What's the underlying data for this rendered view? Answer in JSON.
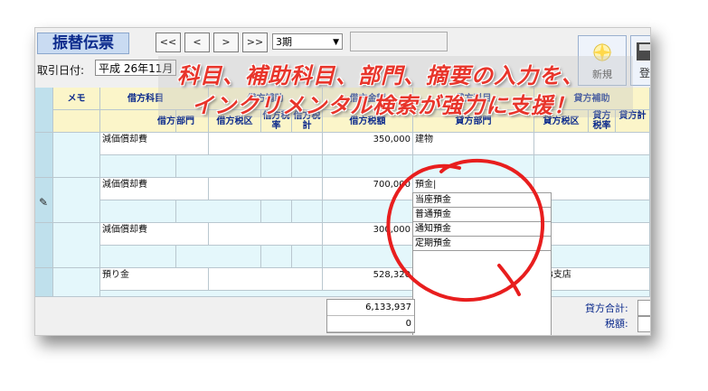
{
  "window": {
    "title": "振替伝票",
    "nav": [
      "<<",
      "<",
      ">",
      ">>"
    ],
    "period": "3期",
    "date_label": "取引日付:",
    "date_value": "平成 26年11月",
    "new_label": "新規",
    "register_label": "登"
  },
  "headers": {
    "memo": "メモ",
    "debit_account": "借方科目",
    "debit_sub": "借方補助",
    "debit_amount": "借方金額",
    "credit_account": "貸方科目",
    "credit_sub": "貸方補助",
    "debit_short": "借方",
    "dept": "部門",
    "debit_tax_class": "借方税区",
    "debit_tax_rate": "借方税率",
    "debit_tax_total": "借方税計",
    "debit_tax": "借方税額",
    "credit_dept": "貸方部門",
    "credit_tax_class": "貸方税区",
    "credit_tax_rate": "貸方税率",
    "credit_total": "貸方計"
  },
  "rows": [
    {
      "debit_account": "減価償却費",
      "amount": "350,000",
      "credit_account": "建物",
      "credit_sub": ""
    },
    {
      "debit_account": "減価償却費",
      "amount": "700,000",
      "credit_account": "預金|",
      "credit_sub": ""
    },
    {
      "debit_account": "減価償却費",
      "amount": "300,000",
      "credit_account": "",
      "credit_sub": ""
    },
    {
      "debit_account": "預り金",
      "amount": "528,320",
      "credit_account": "",
      "credit_sub": "B支店"
    }
  ],
  "suggestions": [
    "当座預金",
    "普通預金",
    "通知預金",
    "定期預金"
  ],
  "totals": {
    "debit_total": "6,133,937",
    "tax_total": "0",
    "credit_label": "貸方合計:",
    "tax_label": "税額:"
  },
  "banner": {
    "line1": "科目、補助科目、部門、摘要の入力を、",
    "line2": "インクリメンタル検索が強力に支援！"
  },
  "colors": {
    "accent_red": "#e8352b",
    "header_yellow": "#fbf5c9",
    "row_cyan": "#e4f7fb",
    "title_blue": "#0b2a8c"
  }
}
